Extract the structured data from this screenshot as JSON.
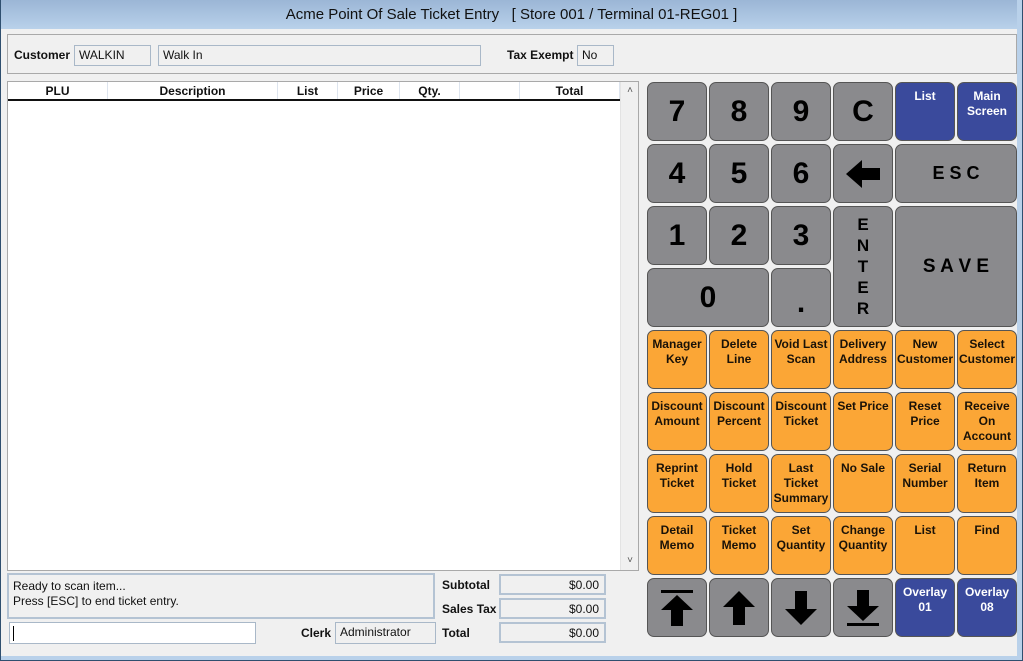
{
  "window": {
    "title": "Acme Point Of Sale Ticket Entry   [ Store 001 / Terminal 01-REG01 ]"
  },
  "customer": {
    "label": "Customer",
    "code": "WALKIN",
    "name": "Walk In",
    "tax_exempt_label": "Tax Exempt",
    "tax_exempt_value": "No"
  },
  "grid": {
    "columns": [
      "PLU",
      "Description",
      "List",
      "Price",
      "Qty.",
      "",
      "Total"
    ],
    "rows": []
  },
  "status": {
    "line1": "Ready to scan item...",
    "line2": "Press [ESC] to end ticket entry."
  },
  "scan_input": {
    "value": ""
  },
  "clerk": {
    "label": "Clerk",
    "value": "Administrator"
  },
  "totals": {
    "subtotal_label": "Subtotal",
    "subtotal": "$0.00",
    "tax_label": "Sales Tax",
    "tax": "$0.00",
    "total_label": "Total",
    "total": "$0.00"
  },
  "keypad": {
    "k7": "7",
    "k8": "8",
    "k9": "9",
    "clear": "C",
    "list_top": "List",
    "main_screen": "Main Screen",
    "k4": "4",
    "k5": "5",
    "k6": "6",
    "esc": "E S C",
    "k1": "1",
    "k2": "2",
    "k3": "3",
    "enter": "E N T E R",
    "save": "S A V E",
    "k0": "0",
    "dot": "."
  },
  "functions": [
    [
      "Manager Key",
      "Delete Line",
      "Void Last Scan",
      "Delivery Address",
      "New Customer",
      "Select Customer"
    ],
    [
      "Discount Amount",
      "Discount Percent",
      "Discount Ticket",
      "Set Price",
      "Reset Price",
      "Receive On Account"
    ],
    [
      "Reprint Ticket",
      "Hold Ticket",
      "Last Ticket Summary",
      "No Sale",
      "Serial Number",
      "Return Item"
    ],
    [
      "Detail Memo",
      "Ticket Memo",
      "Set Quantity",
      "Change Quantity",
      "List",
      "Find"
    ]
  ],
  "nav": {
    "overlay1": "Overlay 01",
    "overlay8": "Overlay 08"
  },
  "colors": {
    "gray_key": "#8a8a8d",
    "blue_key": "#3a4a9c",
    "orange_key": "#fba636"
  }
}
